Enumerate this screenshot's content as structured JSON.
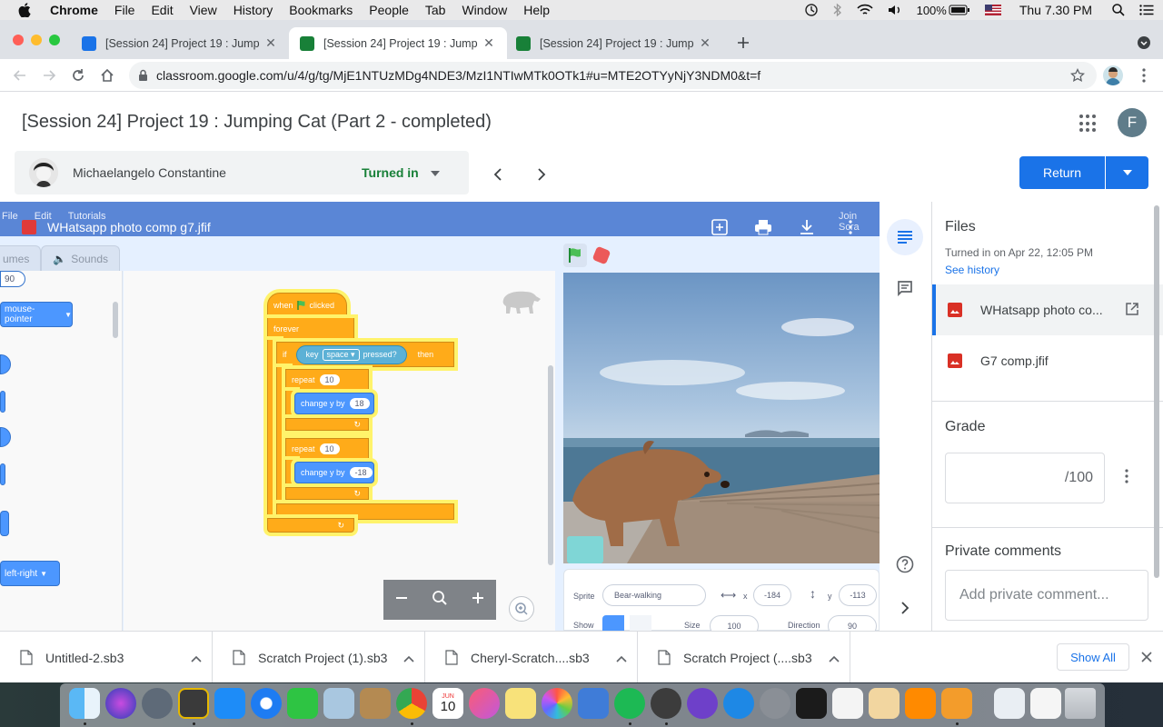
{
  "menubar": {
    "app": "Chrome",
    "items": [
      "File",
      "Edit",
      "View",
      "History",
      "Bookmarks",
      "People",
      "Tab",
      "Window",
      "Help"
    ],
    "battery": "100%",
    "clock": "Thu 7.30 PM"
  },
  "tabs": [
    {
      "title": "[Session 24] Project 19 : Jump",
      "favicon_color": "#1a73e8"
    },
    {
      "title": "[Session 24] Project 19 : Jump",
      "favicon_color": "#188038"
    },
    {
      "title": "[Session 24] Project 19 : Jump",
      "favicon_color": "#188038"
    }
  ],
  "address": {
    "url": "classroom.google.com/u/4/g/tg/MjE1NTUzMDg4NDE3/MzI1NTIwMTk0OTk1#u=MTE2OTYyNjY3NDM0&t=f"
  },
  "header": {
    "title": "[Session 24] Project 19 : Jumping Cat (Part 2 - completed)",
    "account_initial": "F",
    "student_name": "Michaelangelo Constantine",
    "student_status": "Turned in",
    "return_label": "Return"
  },
  "viewer": {
    "file_name": "WHatsapp photo comp g7.jfif",
    "menus": [
      "File",
      "Edit",
      "Tutorials"
    ],
    "join_label": "Join Scra",
    "tabs": [
      "umes",
      "Sounds"
    ],
    "palette": {
      "num_top": "90",
      "mouse_pointer": "mouse-pointer",
      "left_right": "left-right"
    },
    "script": {
      "hat": "when",
      "hat_suffix": "clicked",
      "forever": "forever",
      "if": "if",
      "key_label": "key",
      "key_value": "space",
      "pressed": "pressed?",
      "then": "then",
      "repeat1_label": "repeat",
      "repeat1_value": "10",
      "change1_label": "change y by",
      "change1_value": "18",
      "repeat2_label": "repeat",
      "repeat2_value": "10",
      "change2_label": "change y by",
      "change2_value": "-18"
    },
    "sprite_panel": {
      "sprite_label": "Sprite",
      "sprite_name": "Bear-walking",
      "x_label": "x",
      "x_value": "-184",
      "y_label": "y",
      "y_value": "-113",
      "show_label": "Show",
      "size_label": "Size",
      "size_value": "100",
      "direction_label": "Direction",
      "direction_value": "90"
    }
  },
  "panel": {
    "files_heading": "Files",
    "turned_in": "Turned in on Apr 22, 12:05 PM",
    "see_history": "See history",
    "files": [
      "WHatsapp photo co...",
      "G7 comp.jfif"
    ],
    "grade_heading": "Grade",
    "grade_suffix": "/100",
    "comments_heading": "Private comments",
    "comment_placeholder": "Add private comment..."
  },
  "downloads": {
    "items": [
      "Untitled-2.sb3",
      "Scratch Project (1).sb3",
      "Cheryl-Scratch....sb3",
      "Scratch Project (....sb3"
    ],
    "show_all": "Show All"
  },
  "dock": {
    "calendar_month": "JUN",
    "calendar_day": "10"
  }
}
